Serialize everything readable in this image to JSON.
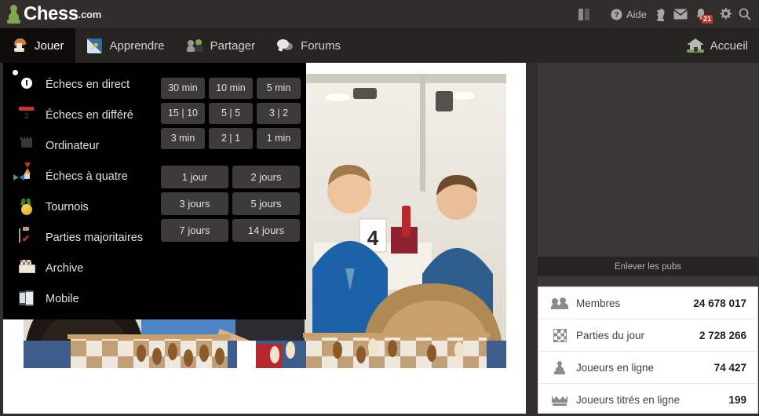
{
  "header": {
    "logo_name": "Chess",
    "logo_suffix": ".com",
    "help_label": "Aide",
    "icons": {
      "book": "book-icon",
      "help": "help-circle-icon",
      "knight": "knight-icon",
      "mail": "envelope-icon",
      "alerts": "bell-icon",
      "settings": "gear-icon",
      "search": "search-icon"
    },
    "notification_count": "21"
  },
  "nav": {
    "items": [
      {
        "label": "Jouer",
        "icon": "knight-icon",
        "active": true
      },
      {
        "label": "Apprendre",
        "icon": "learn-icon",
        "active": false
      },
      {
        "label": "Partager",
        "icon": "people-icon",
        "active": false
      },
      {
        "label": "Forums",
        "icon": "speech-bubble-icon",
        "active": false
      }
    ],
    "home_label": "Accueil",
    "home_icon": "home-icon"
  },
  "dropdown": {
    "items": [
      {
        "label": "Échecs en direct",
        "icon": "live-clock-icon"
      },
      {
        "label": "Échecs en différé",
        "icon": "calendar-icon"
      },
      {
        "label": "Ordinateur",
        "icon": "cpu-icon"
      },
      {
        "label": "Échecs à quatre",
        "icon": "four-arrows-icon"
      },
      {
        "label": "Tournois",
        "icon": "medal-icon"
      },
      {
        "label": "Parties majoritaires",
        "icon": "clipboard-icon"
      },
      {
        "label": "Archive",
        "icon": "archive-icon"
      },
      {
        "label": "Mobile",
        "icon": "mobile-icon"
      }
    ],
    "live_time_controls": [
      "30 min",
      "10 min",
      "5 min",
      "15 | 10",
      "5 | 5",
      "3 | 2",
      "3 min",
      "2 | 1",
      "1 min"
    ],
    "daily_time_controls": [
      "1 jour",
      "2 jours",
      "3 jours",
      "5 jours",
      "7 jours",
      "14 jours"
    ]
  },
  "sidebar": {
    "remove_ads_label": "Enlever les pubs",
    "stats": [
      {
        "label": "Membres",
        "value": "24 678 017",
        "icon": "members-icon"
      },
      {
        "label": "Parties du jour",
        "value": "2 728 266",
        "icon": "chessboard-icon"
      },
      {
        "label": "Joueurs en ligne",
        "value": "74 427",
        "icon": "pawn-icon"
      },
      {
        "label": "Joueurs titrés en ligne",
        "value": "199",
        "icon": "crown-icon"
      }
    ]
  },
  "main": {
    "hero_alt": "chess tournament hall photo"
  },
  "colors": {
    "brand_green": "#7fa650",
    "header_bg": "#302d2a",
    "nav_bg": "#262421",
    "dropdown_bg": "#000000",
    "badge_red": "#c0392b",
    "page_bg": "#312e2b"
  }
}
